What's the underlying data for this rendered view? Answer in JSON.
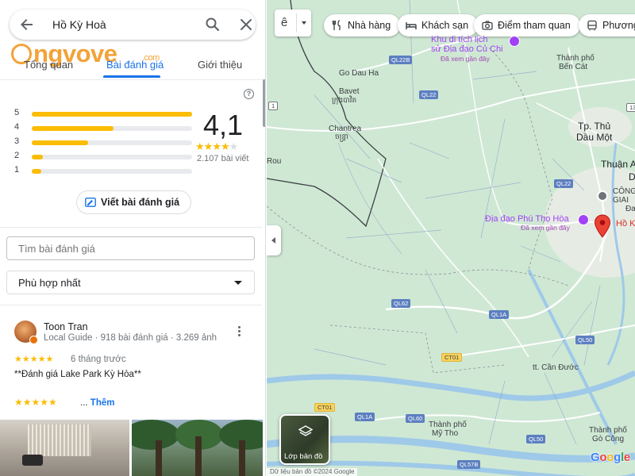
{
  "search": {
    "query": "Hồ Kỳ Hoà"
  },
  "watermark": {
    "text": "ngvove",
    "suffix": ".com"
  },
  "tabs": [
    {
      "label": "Tổng quan",
      "active": false
    },
    {
      "label": "Bài đánh giá",
      "active": true
    },
    {
      "label": "Giới thiệu",
      "active": false
    }
  ],
  "ratings": {
    "score": "4,1",
    "stars_filled": 4,
    "review_count": "2.107 bài viết",
    "distribution": [
      {
        "stars": "5",
        "fraction": 1.0
      },
      {
        "stars": "4",
        "fraction": 0.51
      },
      {
        "stars": "3",
        "fraction": 0.35
      },
      {
        "stars": "2",
        "fraction": 0.07
      },
      {
        "stars": "1",
        "fraction": 0.06
      }
    ]
  },
  "write_review": {
    "label": "Viết bài đánh giá"
  },
  "review_search": {
    "placeholder": "Tìm bài đánh giá"
  },
  "sort": {
    "selected": "Phù hợp nhất"
  },
  "review": {
    "name": "Toon Tran",
    "meta": "Local Guide · 918 bài đánh giá · 3.269 ảnh",
    "stars": "★★★★★",
    "time": "6 tháng trước",
    "text": "**Đánh giá Lake Park Kỳ Hòa**",
    "emoji_row": "★★★★★",
    "more_dots": "...",
    "more_label": "Thêm"
  },
  "map": {
    "lang_glyph": "ê",
    "chips": [
      {
        "label": "Nhà hàng",
        "icon": "fork-knife-icon"
      },
      {
        "label": "Khách sạn",
        "icon": "bed-icon"
      },
      {
        "label": "Điểm tham quan",
        "icon": "camera-icon"
      },
      {
        "label": "Phương ti",
        "icon": "bus-icon"
      }
    ],
    "labels": {
      "cuchi_1": "Khu di tích lịch",
      "cuchi_2": "sử Địa đạo Củ Chi",
      "cuchi_sub": "Đã xem gần đây",
      "bencat_1": "Thành phố",
      "bencat_2": "Bến Cát",
      "godauha": "Go Dau Ha",
      "bavet": "Bavet",
      "bavet_km": "ក្រុងបាវិត",
      "chantrea": "Chantrea",
      "chantrea_km": "ចន្ទ្រា",
      "rou": "Rou",
      "thu_1": "Tp. Thủ",
      "thu_2": "Dầu Một",
      "thuan_a": "Thuận A",
      "d": "D",
      "congviec": "CÔNG",
      "giai": "GIAI",
      "da": "Đa",
      "phutho": "Địa đạo Phú Thọ Hòa",
      "phutho_sub": "Đã xem gần đây",
      "hok": "Hồ K",
      "tx_candu": "tt. Cần Đước",
      "mytho_1": "Thành phố",
      "mytho_2": "Mỹ Tho",
      "gocong_1": "Thành phố",
      "gocong_2": "Gò Công"
    },
    "shields": {
      "ql22b": "QL22B",
      "ql22": "QL22",
      "ql22_2": "QL22",
      "ql62": "QL62",
      "ql1a": "QL1A",
      "ql1a_2": "QL1A",
      "ql50": "QL50",
      "ql50_2": "QL50",
      "ct01": "CT01",
      "ct01_2": "CT01",
      "ql60": "QL60",
      "ql57b": "QL57B",
      "r1": "1",
      "r13": "13"
    },
    "layer_label": "Lớp bản đồ",
    "google": "Google",
    "attribution": "Dữ liệu bản đồ ©2024 Google"
  },
  "colors": {
    "accent": "#1a73e8",
    "star": "#fbbc04",
    "map_land": "#cfe8d4",
    "pin": "#ea4335",
    "poi": "#a142f4"
  }
}
